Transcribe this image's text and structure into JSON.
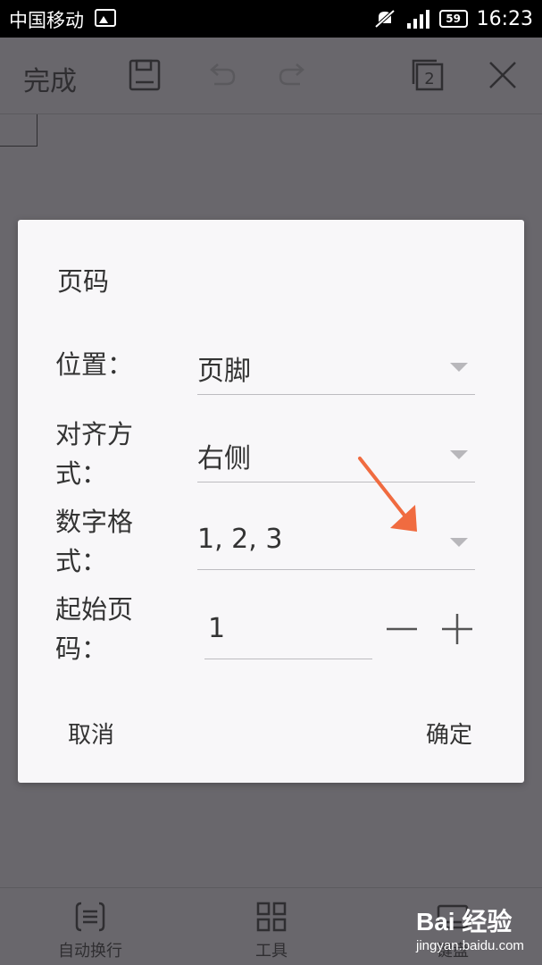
{
  "status_bar": {
    "carrier": "中国移动",
    "battery": "59",
    "time": "16:23"
  },
  "toolbar": {
    "done_label": "完成",
    "icons": [
      "save-icon",
      "undo-icon",
      "redo-icon",
      "multi-window-icon",
      "close-icon"
    ],
    "window_count": "2"
  },
  "dialog": {
    "title": "页码",
    "position": {
      "label": "位置：",
      "value": "页脚"
    },
    "alignment": {
      "label": "对齐方式：",
      "value": "右侧"
    },
    "number_format": {
      "label": "数字格式：",
      "value": "1, 2, 3"
    },
    "start_page": {
      "label": "起始页码：",
      "value": "1"
    },
    "cancel_label": "取消",
    "ok_label": "确定"
  },
  "bottom_nav": {
    "items": [
      {
        "label": "自动换行",
        "icon": "wrap-text-icon"
      },
      {
        "label": "工具",
        "icon": "grid-icon"
      },
      {
        "label": "键盘",
        "icon": "keyboard-icon"
      }
    ]
  },
  "watermark": {
    "brand": "Bai 经验",
    "url": "jingyan.baidu.com"
  },
  "colors": {
    "dialog_bg": "#f8f7f9",
    "overlay": "#69676c",
    "arrow": "#f06b40"
  }
}
